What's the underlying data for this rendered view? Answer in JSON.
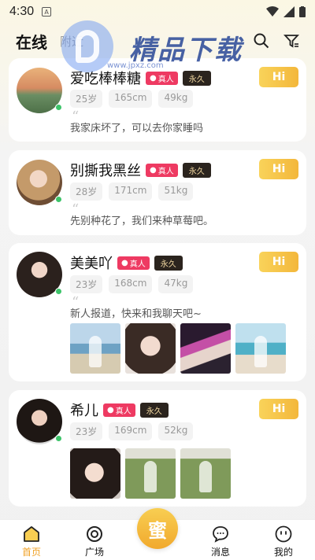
{
  "status_bar": {
    "time": "4:30",
    "notif_letter": "A"
  },
  "header": {
    "tab_online": "在线",
    "tab_nearby": "附近"
  },
  "watermark": {
    "text": "精品下载",
    "url": "www.jpxz.com"
  },
  "users": [
    {
      "name": "爱吃棒棒糖",
      "badge_real": "真人",
      "badge_forever": "永久",
      "age": "25岁",
      "height": "165cm",
      "weight": "49kg",
      "message": "我家床坏了，可以去你家睡吗",
      "hi": "Hi"
    },
    {
      "name": "别撕我黑丝",
      "badge_real": "真人",
      "badge_forever": "永久",
      "age": "28岁",
      "height": "171cm",
      "weight": "51kg",
      "message": "先别种花了，我们来种草莓吧。",
      "hi": "Hi"
    },
    {
      "name": "美美吖",
      "badge_real": "真人",
      "badge_forever": "永久",
      "age": "23岁",
      "height": "168cm",
      "weight": "47kg",
      "message": "新人报道，快来和我聊天吧~",
      "hi": "Hi"
    },
    {
      "name": "希儿",
      "badge_real": "真人",
      "badge_forever": "永久",
      "age": "23岁",
      "height": "169cm",
      "weight": "52kg",
      "message": "",
      "hi": "Hi"
    }
  ],
  "bottom_nav": {
    "home": "首页",
    "plaza": "广场",
    "center": "蜜",
    "messages": "消息",
    "mine": "我的"
  },
  "colors": {
    "accent": "#f3b73b",
    "real_badge": "#ee3a62",
    "online": "#3dc46a"
  }
}
